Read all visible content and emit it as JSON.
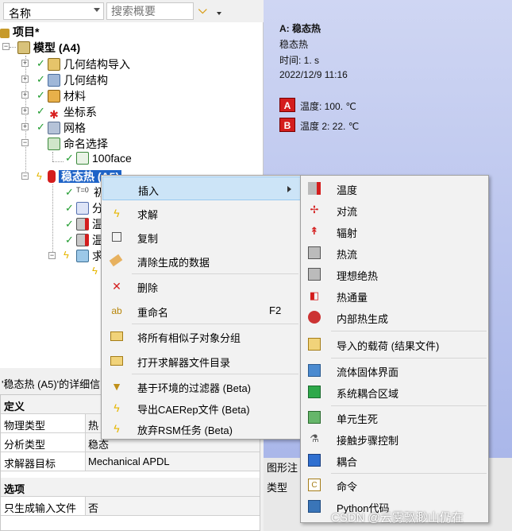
{
  "toolbar": {
    "name_combo": "名称",
    "search_placeholder": "搜索概要"
  },
  "tree": {
    "project": "项目*",
    "model": "模型 (A4)",
    "geometry_import": "几何结构导入",
    "geometry": "几何结构",
    "materials": "材料",
    "coordinate_systems": "坐标系",
    "mesh": "网格",
    "named_selections": "命名选择",
    "face_100": "100face",
    "steady_thermal": "稳态热 (A5)",
    "partial": {
      "c1": "初",
      "c2": "分",
      "c3": "温",
      "c4": "温",
      "c5": "求"
    },
    "t0": "T=0"
  },
  "graphics": {
    "title": "A: 稳态热",
    "subtitle": "稳态热",
    "time": "时间: 1. s",
    "date": "2022/12/9 11:16",
    "loads": [
      {
        "badge": "A",
        "label": "温度: 100. ℃",
        "color": "#d41d1d"
      },
      {
        "badge": "B",
        "label": "温度 2: 22. ℃",
        "color": "#d41d1d"
      }
    ]
  },
  "details": {
    "header": "'稳态热 (A5)'的详细信",
    "rows": [
      {
        "key": "定义",
        "value": "",
        "section": true
      },
      {
        "key": "物理类型",
        "value": "热"
      },
      {
        "key": "分析类型",
        "value": "稳态"
      },
      {
        "key": "求解器目标",
        "value": "Mechanical APDL"
      },
      {
        "key": "选项",
        "value": "",
        "section": true
      },
      {
        "key": "只生成输入文件",
        "value": "否"
      }
    ]
  },
  "bottom_tabs": {
    "graphics_tab": "图形注",
    "type_label": "类型"
  },
  "context_menu": {
    "items": [
      {
        "label": "插入",
        "icon": "insert-icon",
        "shortcut": "",
        "submenu": true
      },
      {
        "label": "求解",
        "icon": "solve-bolt-icon",
        "shortcut": ""
      },
      {
        "label": "复制",
        "icon": "duplicate-icon",
        "shortcut": ""
      },
      {
        "label": "清除生成的数据",
        "icon": "eraser-icon",
        "shortcut": ""
      },
      {
        "label": "删除",
        "icon": "delete-x-icon",
        "shortcut": ""
      },
      {
        "label": "重命名",
        "icon": "rename-icon",
        "shortcut": "F2"
      },
      {
        "label": "将所有相似子对象分组",
        "icon": "folder-icon",
        "shortcut": ""
      },
      {
        "label": "打开求解器文件目录",
        "icon": "open-folder-icon",
        "shortcut": ""
      },
      {
        "label": "基于环境的过滤器 (Beta)",
        "icon": "filter-funnel-icon",
        "shortcut": ""
      },
      {
        "label": "导出CAERep文件 (Beta)",
        "icon": "export-bolt-icon",
        "shortcut": ""
      },
      {
        "label": "放弃RSM任务 (Beta)",
        "icon": "abandon-bolt-icon",
        "shortcut": ""
      }
    ]
  },
  "submenu": {
    "items": [
      {
        "label": "温度",
        "icon": "temperature-icon"
      },
      {
        "label": "对流",
        "icon": "convection-fan-icon"
      },
      {
        "label": "辐射",
        "icon": "radiation-icon"
      },
      {
        "label": "热流",
        "icon": "heat-flow-icon"
      },
      {
        "label": "理想绝热",
        "icon": "perfect-insulation-icon"
      },
      {
        "label": "热通量",
        "icon": "heat-flux-icon"
      },
      {
        "label": "内部热生成",
        "icon": "internal-heat-generation-icon"
      },
      {
        "label": "导入的载荷 (结果文件)",
        "icon": "imported-load-icon"
      },
      {
        "label": "流体固体界面",
        "icon": "fluid-solid-interface-icon"
      },
      {
        "label": "系统耦合区域",
        "icon": "system-coupling-region-icon"
      },
      {
        "label": "单元生死",
        "icon": "element-birth-death-icon"
      },
      {
        "label": "接触步骤控制",
        "icon": "contact-step-control-icon"
      },
      {
        "label": "耦合",
        "icon": "coupling-icon"
      },
      {
        "label": "命令",
        "icon": "commands-icon"
      },
      {
        "label": "Python代码",
        "icon": "python-code-icon"
      }
    ]
  },
  "watermark": "CSDN @云雾飘渺山仍在"
}
